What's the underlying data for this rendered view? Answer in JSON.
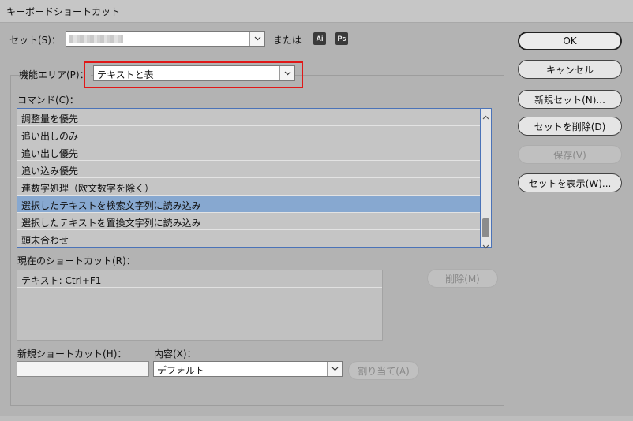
{
  "window": {
    "title": "キーボードショートカット"
  },
  "set": {
    "label": "セット(S)：",
    "or_label": "または",
    "ai_icon_text": "Ai",
    "ps_icon_text": "Ps"
  },
  "feature_area": {
    "label": "機能エリア(P)：",
    "value": "テキストと表"
  },
  "commands": {
    "label": "コマンド(C)：",
    "items": [
      "調整量を優先",
      "追い出しのみ",
      "追い出し優先",
      "追い込み優先",
      "連数字処理（欧文数字を除く）",
      "選択したテキストを検索文字列に読み込み",
      "選択したテキストを置換文字列に読み込み",
      "頭末合わせ"
    ],
    "selected_index": 5
  },
  "current_shortcut": {
    "label": "現在のショートカット(R)：",
    "items": [
      "テキスト: Ctrl+F1"
    ]
  },
  "new_shortcut": {
    "label": "新規ショートカット(H)：",
    "value": ""
  },
  "context": {
    "label": "内容(X)：",
    "value": "デフォルト"
  },
  "buttons": {
    "ok": "OK",
    "cancel": "キャンセル",
    "new_set": "新規セット(N)...",
    "delete_set": "セットを削除(D)",
    "save": "保存(V)",
    "show_set": "セットを表示(W)...",
    "remove": "削除(M)",
    "assign": "割り当て(A)"
  }
}
